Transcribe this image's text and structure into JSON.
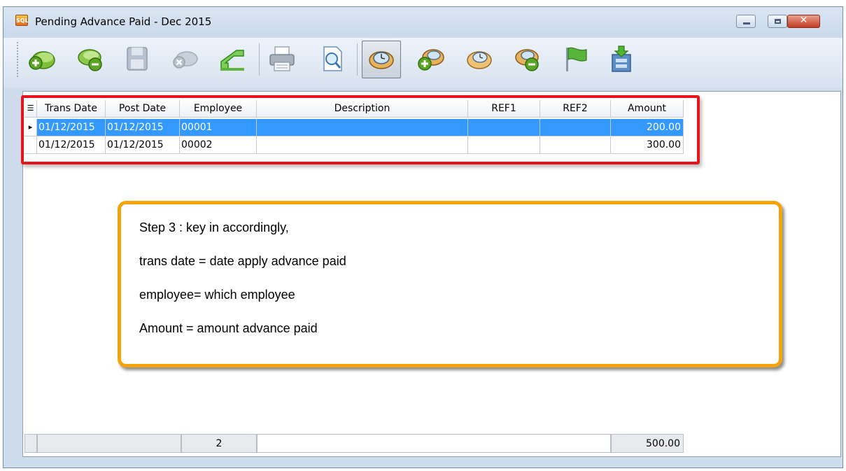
{
  "window": {
    "title": "Pending Advance Paid - Dec 2015",
    "app_icon_text": "SQL"
  },
  "window_controls": {
    "close_glyph": "✕"
  },
  "toolbar": {
    "buttons": [
      "add-icon",
      "delete-icon",
      "save-icon",
      "cancel-icon",
      "undo-icon",
      "print-icon",
      "preview-icon",
      "timeline-icon",
      "timeline-add-icon",
      "timeline-edit-icon",
      "timeline-remove-icon",
      "flag-icon",
      "export-icon"
    ]
  },
  "grid": {
    "columns": [
      "Trans Date",
      "Post Date",
      "Employee",
      "Description",
      "REF1",
      "REF2",
      "Amount"
    ],
    "rows": [
      {
        "trans_date": "01/12/2015",
        "post_date": "01/12/2015",
        "employee": "00001",
        "description": "",
        "ref1": "",
        "ref2": "",
        "amount": "200.00"
      },
      {
        "trans_date": "01/12/2015",
        "post_date": "01/12/2015",
        "employee": "00002",
        "description": "",
        "ref1": "",
        "ref2": "",
        "amount": "300.00"
      }
    ],
    "footer": {
      "count": "2",
      "total": "500.00"
    }
  },
  "callout": {
    "lines": [
      "Step 3 : key in accordingly,",
      "trans date = date apply advance paid",
      "employee= which employee",
      "Amount = amount advance paid"
    ]
  },
  "colors": {
    "selection": "#3399ff",
    "highlight_border": "#e8141c",
    "callout_border": "#f5a30a"
  }
}
